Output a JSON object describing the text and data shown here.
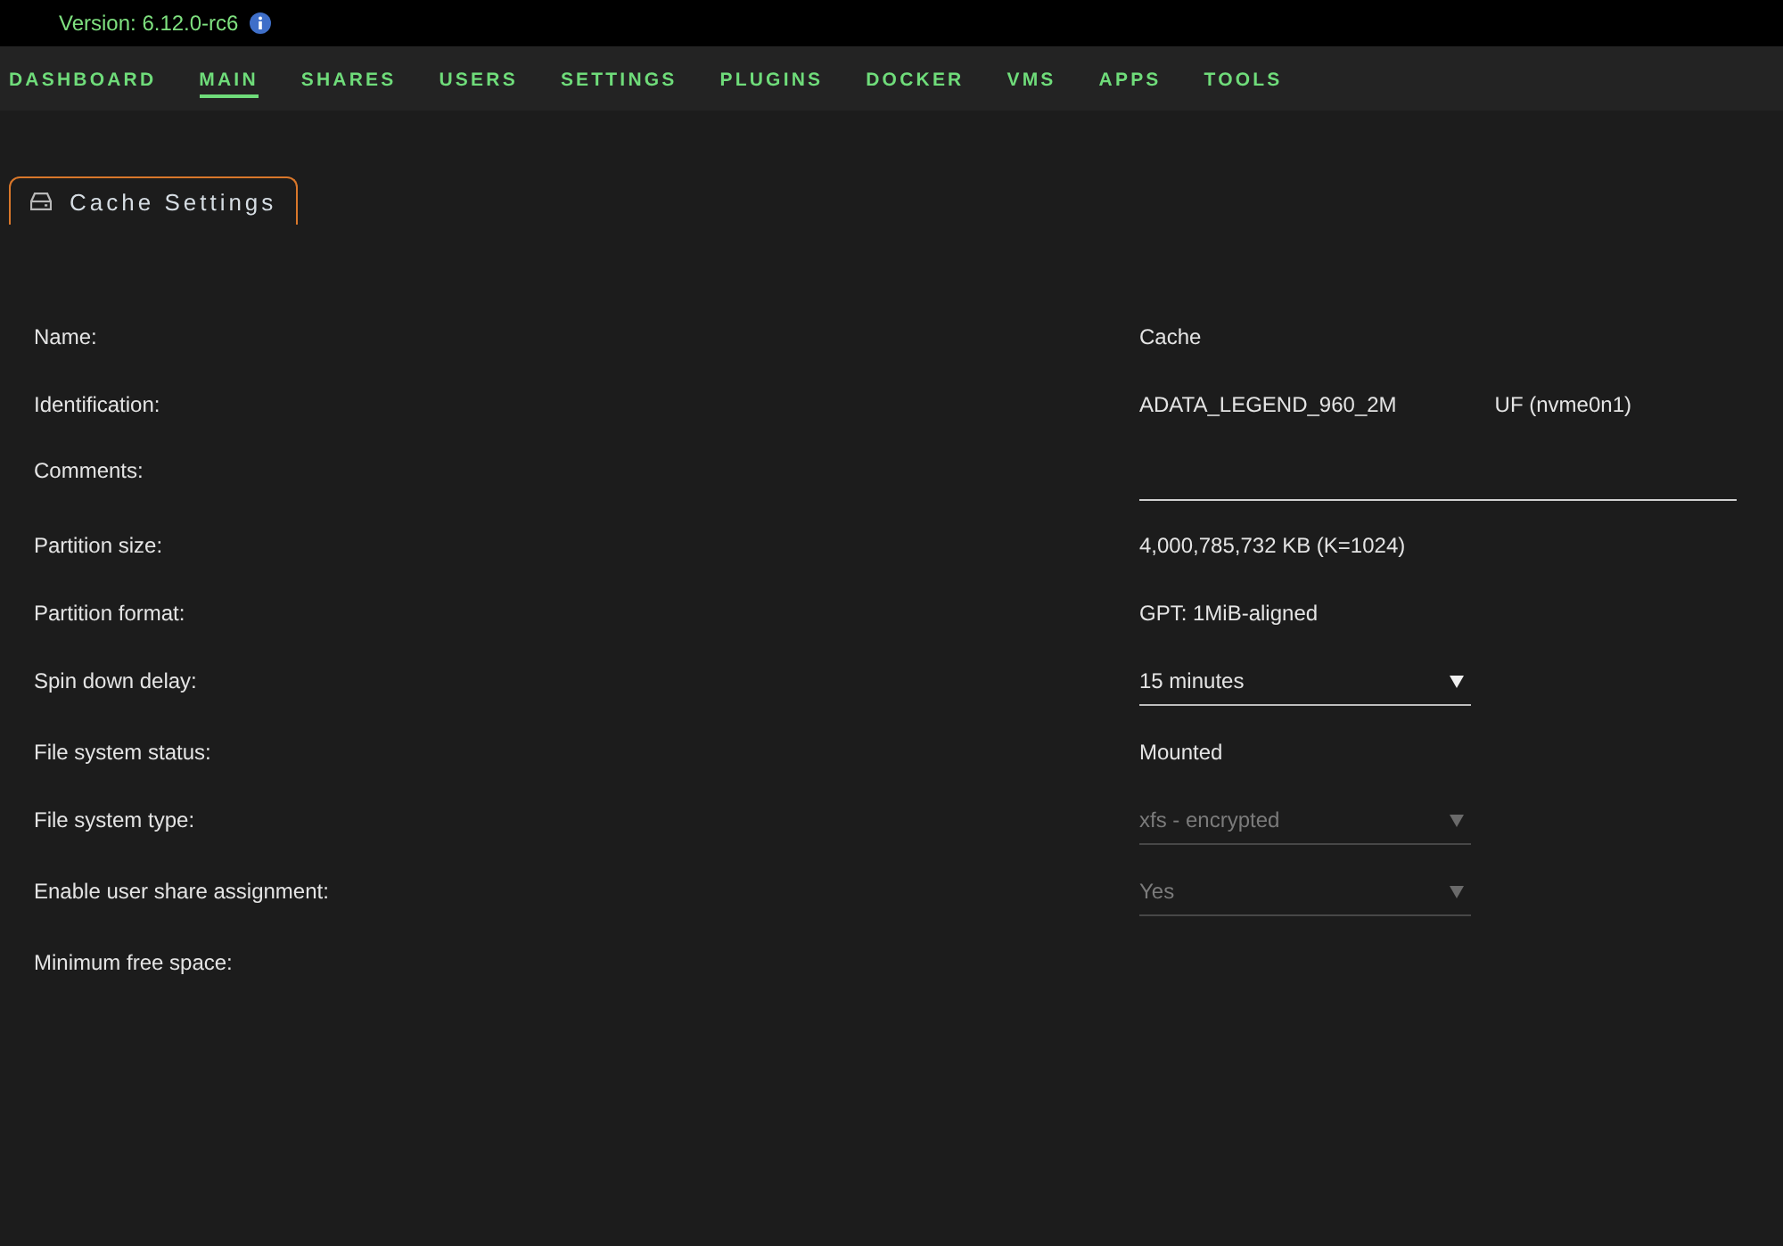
{
  "header": {
    "version": "Version: 6.12.0-rc6"
  },
  "nav": [
    {
      "label": "DASHBOARD",
      "selected": false
    },
    {
      "label": "MAIN",
      "selected": true
    },
    {
      "label": "SHARES",
      "selected": false
    },
    {
      "label": "USERS",
      "selected": false
    },
    {
      "label": "SETTINGS",
      "selected": false
    },
    {
      "label": "PLUGINS",
      "selected": false
    },
    {
      "label": "DOCKER",
      "selected": false
    },
    {
      "label": "VMS",
      "selected": false
    },
    {
      "label": "APPS",
      "selected": false
    },
    {
      "label": "TOOLS",
      "selected": false
    }
  ],
  "tabs": [
    {
      "label": "Cache Settings",
      "selected": true
    }
  ],
  "form": {
    "rows": [
      {
        "label": "Name:",
        "kind": "text",
        "value": "Cache"
      },
      {
        "label": "Identification:",
        "kind": "redacted",
        "parts": [
          "ADATA_LEGEND_960_2M",
          "UF (nvme0n1)"
        ]
      },
      {
        "label": "Comments:",
        "kind": "input"
      },
      {
        "label": "Partition size:",
        "kind": "text",
        "value": "4,000,785,732 KB (K=1024)"
      },
      {
        "label": "Partition format:",
        "kind": "text",
        "value": "GPT: 1MiB-aligned"
      },
      {
        "label": "Spin down delay:",
        "kind": "select",
        "value": "15 minutes",
        "disabled": false
      },
      {
        "label": "File system status:",
        "kind": "text",
        "value": "Mounted"
      },
      {
        "label": "File system type:",
        "kind": "select",
        "value": "xfs - encrypted",
        "disabled": true
      },
      {
        "label": "Enable user share assignment:",
        "kind": "select",
        "value": "Yes",
        "disabled": true
      },
      {
        "label": "Minimum free space:",
        "kind": "blank"
      }
    ]
  }
}
